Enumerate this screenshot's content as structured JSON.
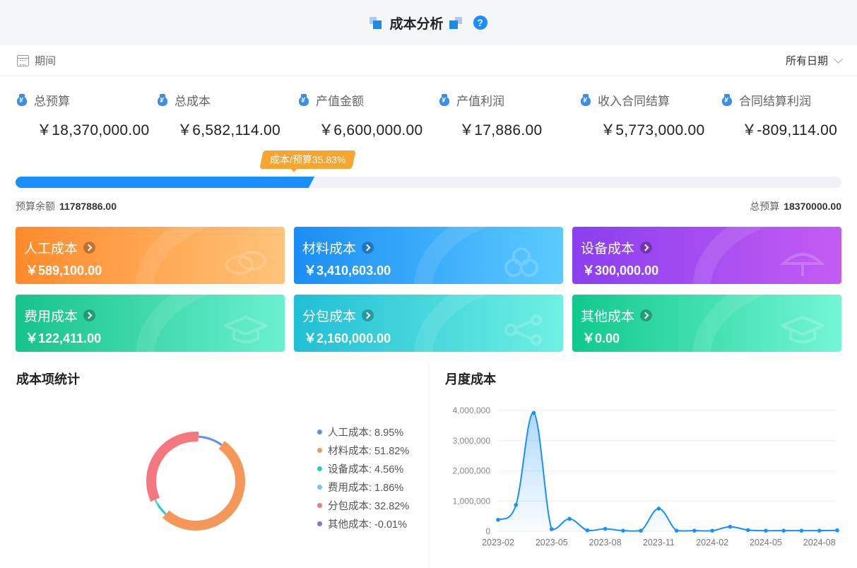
{
  "header": {
    "title": "成本分析",
    "help_icon": "?"
  },
  "period": {
    "label": "期间",
    "value": "所有日期"
  },
  "stats": [
    {
      "label": "总预算",
      "value": "￥18,370,000.00"
    },
    {
      "label": "总成本",
      "value": "￥6,582,114.00"
    },
    {
      "label": "产值金额",
      "value": "￥6,600,000.00"
    },
    {
      "label": "产值利润",
      "value": "￥17,886.00"
    },
    {
      "label": "收入合同结算",
      "value": "￥5,773,000.00"
    },
    {
      "label": "合同结算利润",
      "value": "￥-809,114.00"
    }
  ],
  "progress": {
    "label": "成本/预算35.83%",
    "ratio": 0.3583,
    "remaining_label": "预算余额",
    "remaining_value": "11787886.00",
    "total_label": "总预算",
    "total_value": "18370000.00"
  },
  "cost_cards": [
    {
      "label": "人工成本",
      "value": "￥589,100.00",
      "gradient": [
        "#ff8a2a",
        "#ffc37a"
      ],
      "icon": "coins-icon"
    },
    {
      "label": "材料成本",
      "value": "￥3,410,603.00",
      "gradient": [
        "#1a8ef5",
        "#5ccbff"
      ],
      "icon": "coins-icon"
    },
    {
      "label": "设备成本",
      "value": "￥300,000.00",
      "gradient": [
        "#8a3ff0",
        "#c45cf2"
      ],
      "icon": "umbrella-icon"
    },
    {
      "label": "费用成本",
      "value": "￥122,411.00",
      "gradient": [
        "#17c38a",
        "#6af0cf"
      ],
      "icon": "cap-icon"
    },
    {
      "label": "分包成本",
      "value": "￥2,160,000.00",
      "gradient": [
        "#20bfd6",
        "#6ff0e2"
      ],
      "icon": "network-icon"
    },
    {
      "label": "其他成本",
      "value": "￥0.00",
      "gradient": [
        "#10c98c",
        "#74f6d5"
      ],
      "icon": "cap-icon"
    }
  ],
  "sections": {
    "pie_title": "成本项统计",
    "line_title": "月度成本"
  },
  "chart_data": [
    {
      "type": "pie",
      "title": "成本项统计",
      "slices": [
        {
          "name": "人工成本",
          "value": 8.95,
          "label": "人工成本: 8.95%",
          "color": "#5b8ff9"
        },
        {
          "name": "材料成本",
          "value": 51.82,
          "label": "材料成本: 51.82%",
          "color": "#f6975a"
        },
        {
          "name": "设备成本",
          "value": 4.56,
          "label": "设备成本: 4.56%",
          "color": "#1ad3c5"
        },
        {
          "name": "费用成本",
          "value": 1.86,
          "label": "费用成本: 1.86%",
          "color": "#6dc8ec"
        },
        {
          "name": "分包成本",
          "value": 32.82,
          "label": "分包成本: 32.82%",
          "color": "#f5787e"
        },
        {
          "name": "其他成本",
          "value": -0.01,
          "label": "其他成本: -0.01%",
          "color": "#9270ca"
        }
      ],
      "legend": "right"
    },
    {
      "type": "area",
      "title": "月度成本",
      "x": [
        "2023-02",
        "2023-03",
        "2023-04",
        "2023-05",
        "2023-06",
        "2023-07",
        "2023-08",
        "2023-09",
        "2023-10",
        "2023-11",
        "2023-12",
        "2024-01",
        "2024-02",
        "2024-03",
        "2024-04",
        "2024-05",
        "2024-06",
        "2024-07",
        "2024-08",
        "2024-09"
      ],
      "xticks": [
        "2023-02",
        "2023-05",
        "2023-08",
        "2023-11",
        "2024-02",
        "2024-05",
        "2024-08"
      ],
      "values": [
        380000,
        870000,
        3920000,
        70000,
        410000,
        30000,
        80000,
        20000,
        20000,
        750000,
        20000,
        20000,
        20000,
        150000,
        40000,
        20000,
        20000,
        20000,
        20000,
        30000
      ],
      "yticks": [
        0,
        1000000,
        2000000,
        3000000,
        4000000
      ],
      "ytick_labels": [
        "0",
        "1,000,000",
        "2,000,000",
        "3,000,000",
        "4,000,000"
      ],
      "ylim": [
        0,
        4000000
      ],
      "color": "#1890ff",
      "grid": true
    }
  ]
}
